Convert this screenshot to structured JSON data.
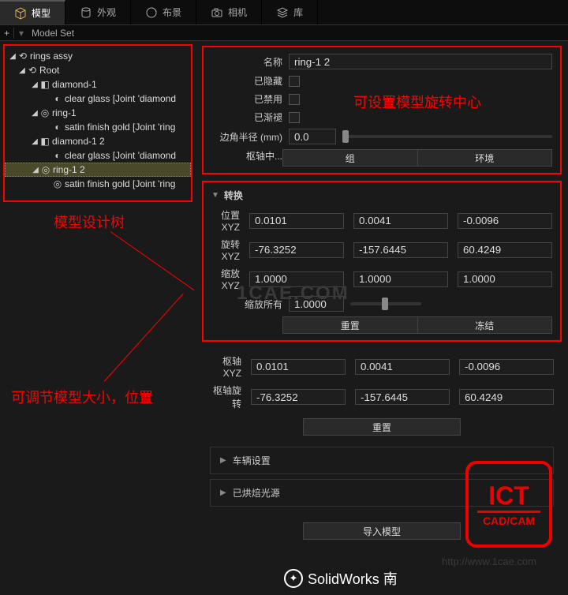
{
  "tabs": {
    "model": "模型",
    "appearance": "外观",
    "scene": "布景",
    "camera": "相机",
    "library": "库"
  },
  "modelset": {
    "plus": "+",
    "label": "Model Set"
  },
  "tree": {
    "n0": "rings assy",
    "n1": "Root",
    "n2": "diamond-1",
    "n3": "clear glass [Joint 'diamond",
    "n4": "ring-1",
    "n5": "satin finish gold [Joint 'ring",
    "n6": "diamond-1 2",
    "n7": "clear glass [Joint 'diamond",
    "n8": "ring-1 2",
    "n9": "satin finish gold [Joint 'ring"
  },
  "captions": {
    "tree": "模型设计树",
    "rotcenter": "可设置模型旋转中心",
    "size": "可调节模型大小，位置"
  },
  "sec1": {
    "name_lbl": "名称",
    "name_val": "ring-1 2",
    "hidden_lbl": "已隐藏",
    "disabled_lbl": "已禁用",
    "fade_lbl": "已渐褪",
    "round_lbl": "边角半径 (mm)",
    "round_val": "0.0",
    "pivot_lbl": "枢轴中...",
    "btn_group": "组",
    "btn_env": "环境"
  },
  "transform": {
    "header": "转换",
    "pos_lbl": "位置 XYZ",
    "pos": [
      "0.0101",
      "0.0041",
      "-0.0096"
    ],
    "rot_lbl": "旋转 XYZ",
    "rot": [
      "-76.3252",
      "-157.6445",
      "60.4249"
    ],
    "scl_lbl": "缩放 XYZ",
    "scl": [
      "1.0000",
      "1.0000",
      "1.0000"
    ],
    "sclall_lbl": "缩放所有",
    "sclall_val": "1.0000",
    "reset": "重置",
    "freeze": "冻结"
  },
  "pivot": {
    "xyz_lbl": "枢轴 XYZ",
    "xyz": [
      "0.0101",
      "0.0041",
      "-0.0096"
    ],
    "rot_lbl": "枢轴旋转",
    "rot": [
      "-76.3252",
      "-157.6445",
      "60.4249"
    ],
    "reset": "重置"
  },
  "acc": {
    "vehicle": "车辆设置",
    "baked": "已烘焙光源",
    "import": "导入模型"
  },
  "logo": {
    "big": "ICT",
    "sm": "CAD/CAM"
  },
  "footer": "SolidWorks 南",
  "wm": "1CAE.COM",
  "wm_link": "http://www.1cae.com"
}
